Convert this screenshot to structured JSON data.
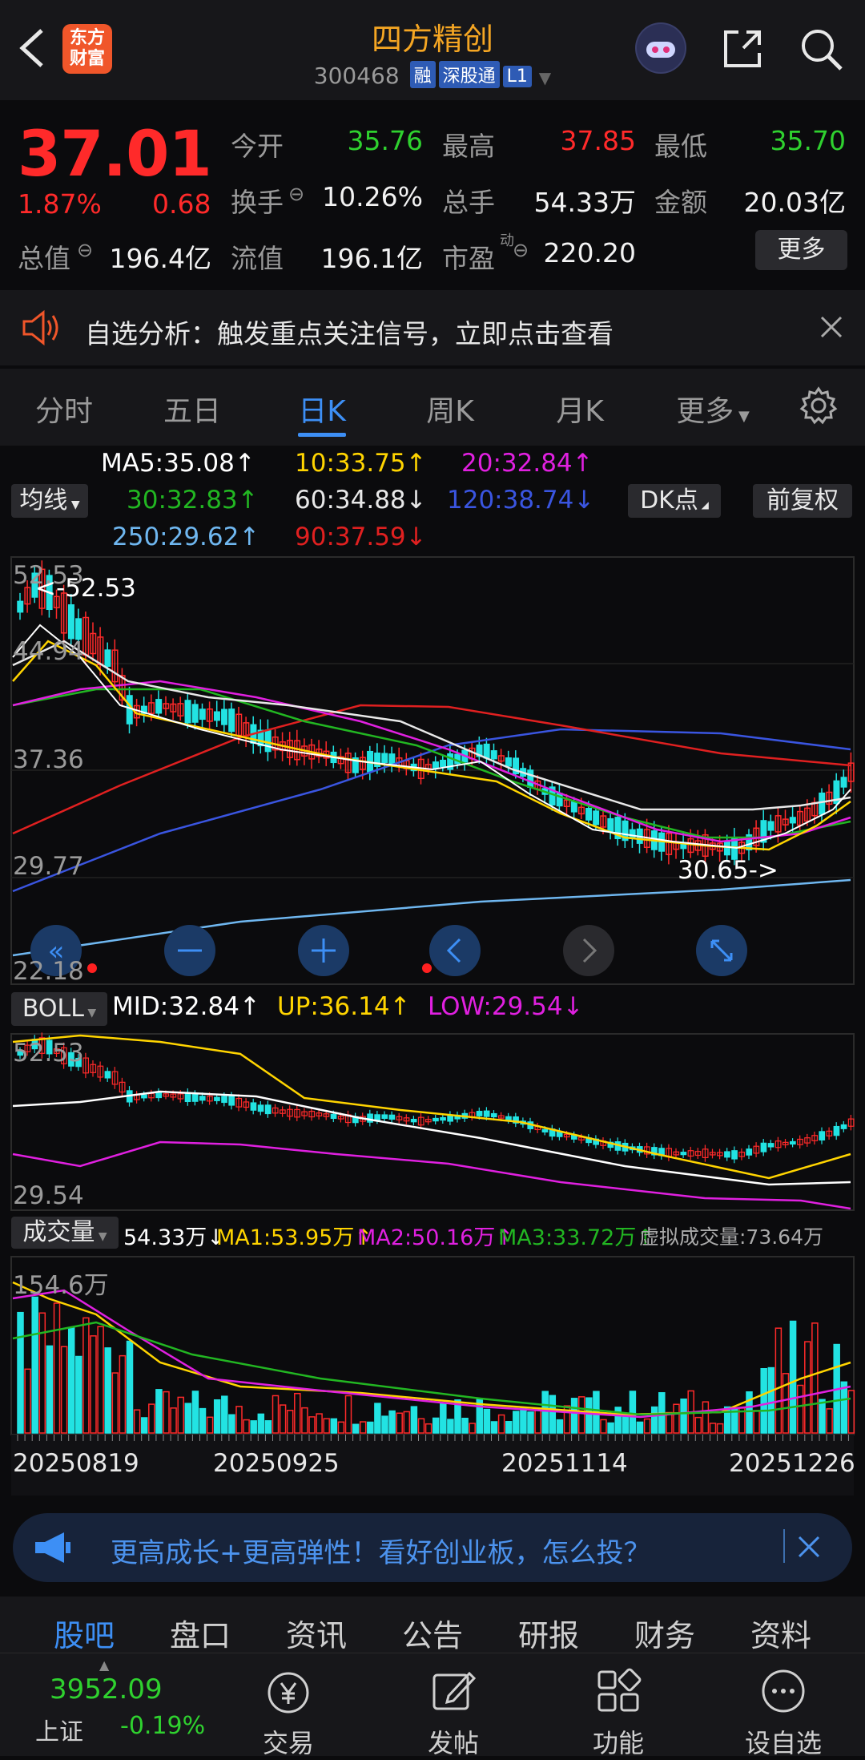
{
  "header": {
    "title": "四方精创",
    "code": "300468",
    "tags": [
      "融",
      "深股通",
      "L1"
    ],
    "logo_text": "东方财富",
    "icons": [
      "back-icon",
      "robot-avatar-icon",
      "share-icon",
      "search-icon"
    ]
  },
  "quote": {
    "price": "37.01",
    "change_pct": "1.87%",
    "change": "0.68",
    "open_label": "今开",
    "open": "35.76",
    "high_label": "最高",
    "high": "37.85",
    "low_label": "最低",
    "low": "35.70",
    "turnover_label": "换手",
    "turnover": "10.26%",
    "volume_label": "总手",
    "volume": "54.33万",
    "amount_label": "金额",
    "amount": "20.03亿",
    "mktcap_label": "总值",
    "mktcap": "196.4亿",
    "float_label": "流值",
    "float": "196.1亿",
    "pe_label": "市盈",
    "pe_sup": "动",
    "pe": "220.20",
    "more_label": "更多"
  },
  "notice": {
    "text": "自选分析：触发重点关注信号，立即点击查看"
  },
  "tabs": [
    "分时",
    "五日",
    "日K",
    "周K",
    "月K",
    "更多"
  ],
  "ma_legend": {
    "btn": "均线",
    "ma5": "MA5:35.08↑",
    "ma10": "10:33.75↑",
    "ma20": "20:32.84↑",
    "ma30": "30:32.83↑",
    "ma60": "60:34.88↓",
    "ma120": "120:38.74↓",
    "ma250": "250:29.62↑",
    "ma90": "90:37.59↓",
    "dk_btn": "DK点",
    "fq_btn": "前复权",
    "colors": {
      "ma5": "#ffffff",
      "ma10": "#ffd400",
      "ma20": "#e020e0",
      "ma30": "#22b622",
      "ma60": "#e8e8e8",
      "ma120": "#3a55e0",
      "ma250": "#6fb7f0",
      "ma90": "#e02020"
    }
  },
  "kline": {
    "y_labels": [
      "52.53",
      "44.94",
      "37.36",
      "29.77",
      "22.18"
    ],
    "max_marker": "<-52.53",
    "min_marker": "30.65->"
  },
  "boll": {
    "btn": "BOLL",
    "mid": "MID:32.84↑",
    "up": "UP:36.14↑",
    "low": "LOW:29.54↓",
    "y_top": "52.53",
    "y_bottom": "29.54"
  },
  "vol": {
    "btn": "成交量",
    "v": "54.33万↓",
    "ma1": "MA1:53.95万↑",
    "ma2": "MA2:50.16万↑",
    "ma3": "MA3:33.72万↑",
    "virtual": "虚拟成交量:73.64万",
    "y_top": "154.6万",
    "dates": [
      "20250819",
      "20250925",
      "20251114",
      "20251226"
    ]
  },
  "banner": {
    "text": "更高成长+更高弹性！看好创业板，怎么投？"
  },
  "bottom_tabs": [
    "股吧",
    "盘口",
    "资讯",
    "公告",
    "研报",
    "财务",
    "资料"
  ],
  "footer": {
    "index_value": "3952.09",
    "index_name": "上证",
    "index_change": "-0.19%",
    "items": [
      "交易",
      "发帖",
      "功能",
      "设自选"
    ]
  }
}
